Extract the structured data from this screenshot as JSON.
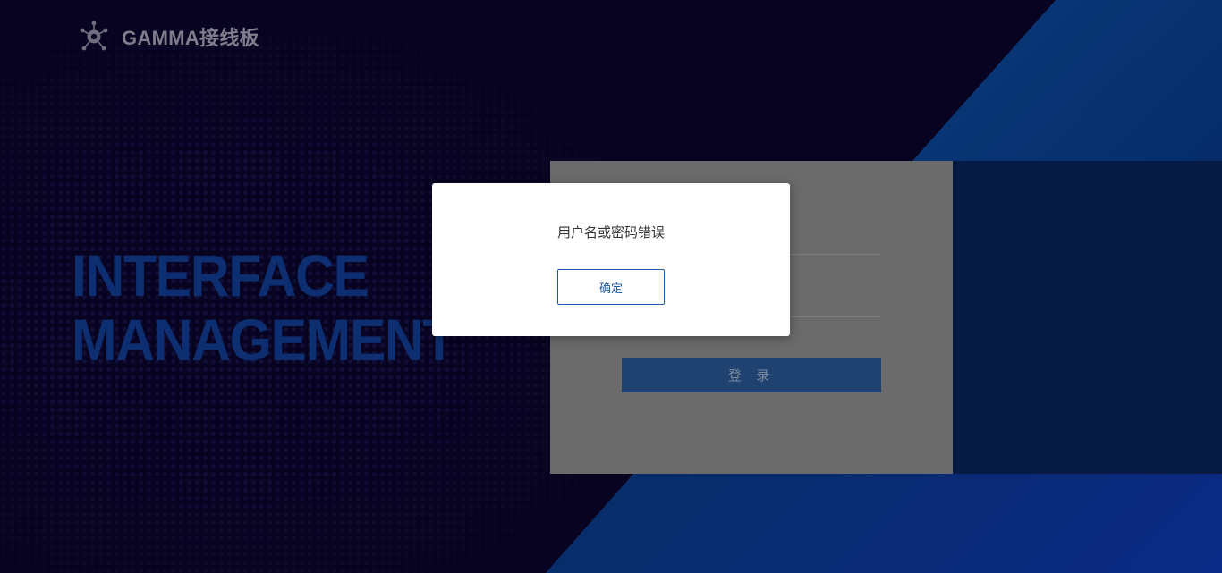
{
  "header": {
    "logo_text": "GAMMA接线板",
    "logo_icon": "network-hub-icon"
  },
  "hero": {
    "line1": "INTERFACE",
    "line2": "MANAGEMENT"
  },
  "login": {
    "submit_label": "登 录"
  },
  "dialog": {
    "message": "用户名或密码错误",
    "ok_label": "确定"
  },
  "colors": {
    "background": "#070321",
    "accent_blue": "#0a3a7a",
    "headline_blue": "#0d2f72",
    "dialog_button": "#1e5aa8"
  }
}
